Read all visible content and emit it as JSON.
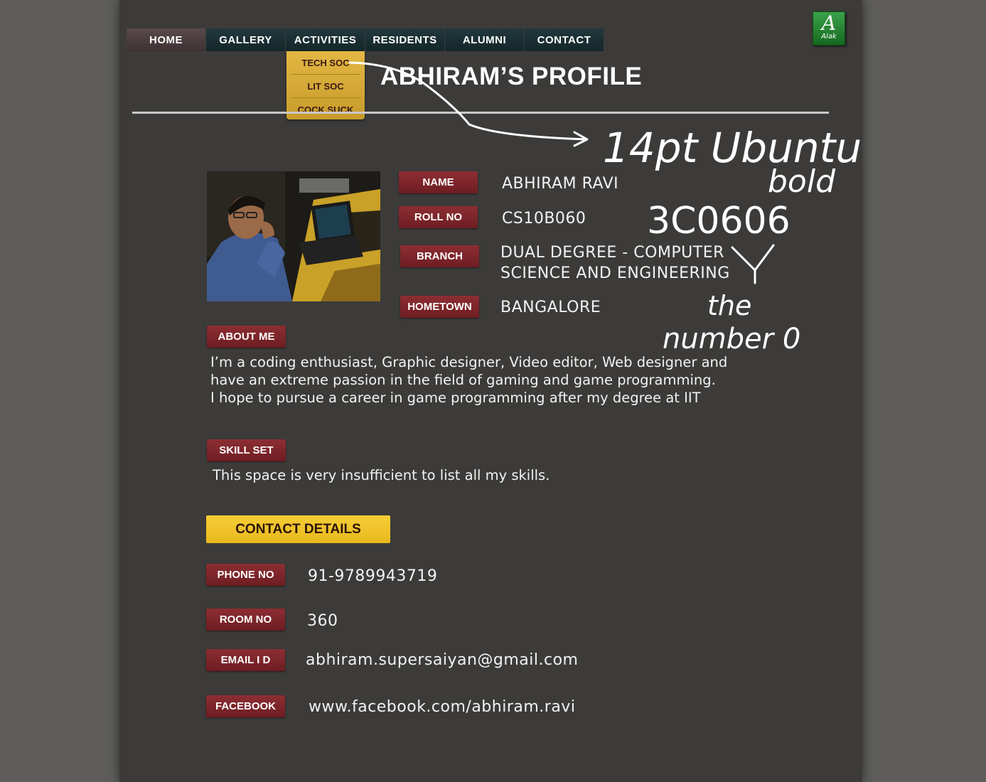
{
  "nav": {
    "items": [
      "HOME",
      "GALLERY",
      "ACTIVITIES",
      "RESIDENTS",
      "ALUMNI",
      "CONTACT"
    ],
    "active": "HOME",
    "dropdown": [
      "TECH SOC",
      "LIT SOC",
      "COCK SUCK"
    ]
  },
  "logo": {
    "letter": "A",
    "text": "Alak"
  },
  "page_title": "ABHIRAM’S PROFILE",
  "profile": {
    "name_label": "NAME",
    "name_value": "ABHIRAM RAVI",
    "roll_label": "ROLL NO",
    "roll_value": "CS10B060",
    "branch_label": "BRANCH",
    "branch_value": "DUAL DEGREE - COMPUTER\nSCIENCE AND ENGINEERING",
    "hometown_label": "HOMETOWN",
    "hometown_value": "BANGALORE"
  },
  "about": {
    "label": "ABOUT ME",
    "text": "I’m a coding enthusiast, Graphic designer, Video editor, Web designer and\nhave an extreme passion in the field of gaming and game programming.\nI hope to pursue a career in game programming after my degree at IIT"
  },
  "skills": {
    "label": "SKILL SET",
    "text": "This space is very insufficient to list all my skills."
  },
  "contact": {
    "heading": "CONTACT DETAILS",
    "phone_label": "PHONE NO",
    "phone_value": "91-9789943719",
    "room_label": "ROOM NO",
    "room_value": "360",
    "email_label": "EMAIL I D",
    "email_value": "abhiram.supersaiyan@gmail.com",
    "facebook_label": "FACEBOOK",
    "facebook_value": "www.facebook.com/abhiram.ravi"
  },
  "annotations": {
    "font_note_1": "14pt Ubuntu",
    "font_note_2": "bold",
    "color_note": "3C0606",
    "zero_note_1": "the",
    "zero_note_2": "number 0"
  },
  "colors": {
    "page_bg": "#3c3b39",
    "outer_bg": "#5e5d5b",
    "nav_bg": "#1a2f33",
    "label_bg": "#7d2529",
    "dropdown_bg": "#d9ab36",
    "contact_head_bg": "#f2c42a"
  }
}
